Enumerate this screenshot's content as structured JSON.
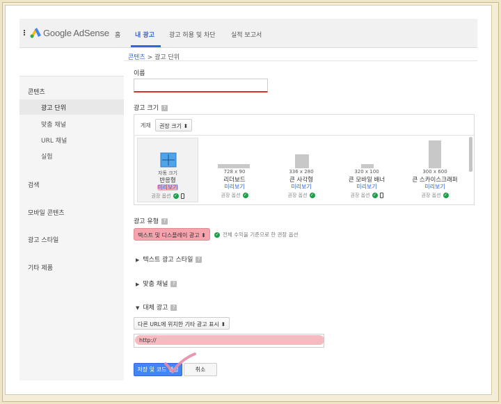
{
  "app": {
    "logo_text": "Google AdSense"
  },
  "nav": {
    "items": [
      {
        "label": "홈"
      },
      {
        "label": "내 광고"
      },
      {
        "label": "광고 허용 및 차단"
      },
      {
        "label": "실적 보고서"
      }
    ],
    "active_index": 1
  },
  "breadcrumb": {
    "parent": "콘텐츠",
    "separator": " > ",
    "current": "광고 단위"
  },
  "sidebar": {
    "section_title": "콘텐츠",
    "sub_items": [
      {
        "label": "광고 단위"
      },
      {
        "label": "맞춤 채널"
      },
      {
        "label": "URL 채널"
      },
      {
        "label": "실험"
      }
    ],
    "sections": [
      {
        "label": "검색"
      },
      {
        "label": "모바일 콘텐츠"
      },
      {
        "label": "광고 스타일"
      },
      {
        "label": "기타 제품"
      }
    ]
  },
  "form": {
    "name_label": "이름",
    "name_value": "",
    "size_label": "광고 크기",
    "post_label": "게재",
    "size_filter": "권장 크기 ⬍",
    "sizes": [
      {
        "dim": "자동 크기",
        "name": "반응형",
        "preview": "미리보기",
        "rec": "권장 옵션"
      },
      {
        "dim": "728 x 90",
        "name": "리더보드",
        "preview": "미리보기",
        "rec": "권장 옵션"
      },
      {
        "dim": "336 x 280",
        "name": "큰 사각형",
        "preview": "미리보기",
        "rec": "권장 옵션"
      },
      {
        "dim": "320 x 100",
        "name": "큰 모바일 배너",
        "preview": "미리보기",
        "rec": "권장 옵션"
      },
      {
        "dim": "300 x 600",
        "name": "큰 스카이스크래퍼",
        "preview": "미리보기",
        "rec": "권장 옵션"
      }
    ],
    "ad_type_label": "광고 유형",
    "ad_type_value": "텍스트 및 디스플레이 광고 ⬍",
    "ad_type_note": "전체 수익을 기준으로 한 권장 옵션",
    "text_style_label": "텍스트 광고 스타일",
    "custom_channel_label": "맞춤 채널",
    "backup_ads_label": "대체 광고",
    "backup_select": "다른 URL에 위치한 기타 광고 표시 ⬍",
    "backup_url": "http://",
    "save_label": "저장 및 코드 생성",
    "cancel_label": "취소"
  },
  "colors": {
    "accent": "#3367d6",
    "save_button": "#4285f4",
    "highlight": "#f7a8b0",
    "check": "#1e9e4a"
  }
}
